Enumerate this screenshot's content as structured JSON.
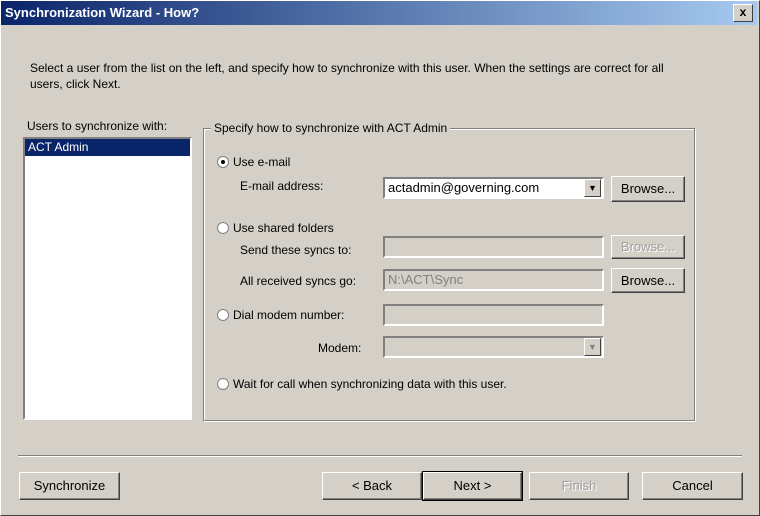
{
  "window": {
    "title": "Synchronization Wizard - How?",
    "close_label": "x"
  },
  "instructions": "Select a user from the list on the left, and specify how to synchronize with this user. When the settings are correct for all users, click Next.",
  "users": {
    "label": "Users to synchronize with:",
    "items": [
      "ACT Admin"
    ]
  },
  "group": {
    "label": "Specify how to synchronize with ACT Admin",
    "email": {
      "radio_label": "Use e-mail",
      "address_label": "E-mail address:",
      "address_value": "actadmin@governing.com",
      "browse": "Browse..."
    },
    "shared": {
      "radio_label": "Use shared folders",
      "send_label": "Send these syncs to:",
      "send_value": "",
      "send_browse": "Browse...",
      "received_label": "All received syncs go:",
      "received_value": "N:\\ACT\\Sync",
      "received_browse": "Browse..."
    },
    "dial": {
      "radio_label": "Dial modem number:",
      "number_value": "",
      "modem_label": "Modem:",
      "modem_value": ""
    },
    "wait": {
      "radio_label": "Wait for call when synchronizing data with this user."
    }
  },
  "buttons": {
    "synchronize": "Synchronize",
    "back": "< Back",
    "next": "Next >",
    "finish": "Finish",
    "cancel": "Cancel"
  }
}
